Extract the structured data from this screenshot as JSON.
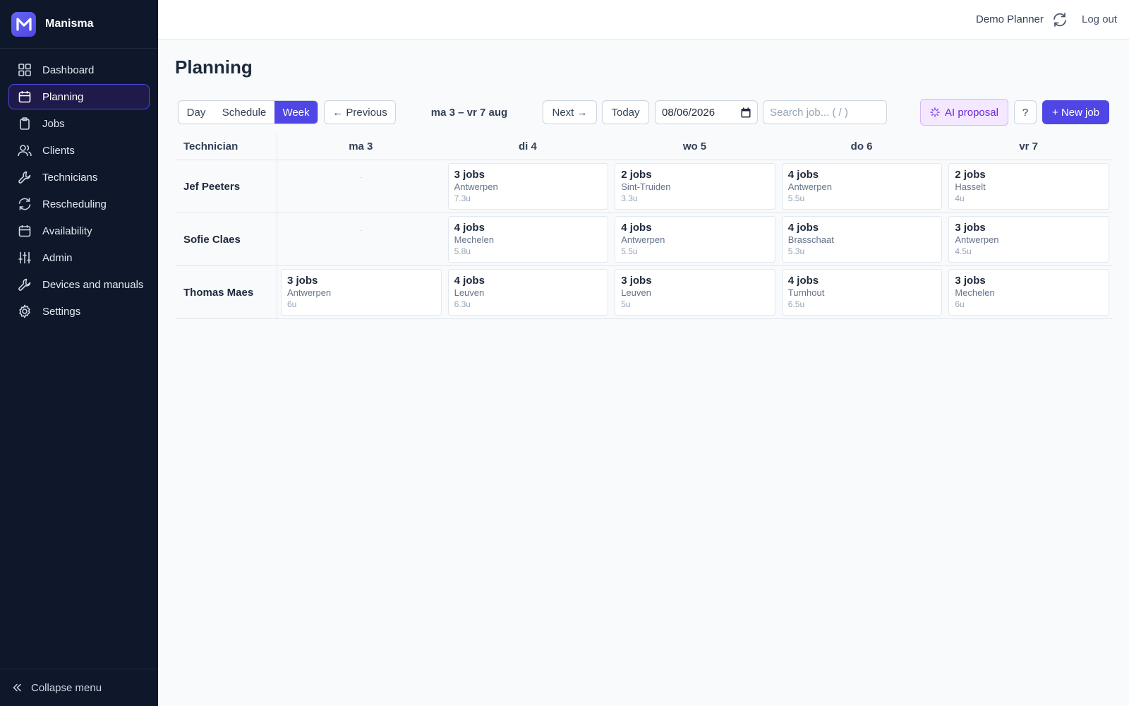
{
  "app": {
    "name": "Manisma"
  },
  "sidebar": {
    "items": [
      {
        "label": "Dashboard",
        "icon": "grid-icon",
        "active": false
      },
      {
        "label": "Planning",
        "icon": "calendar-icon",
        "active": true
      },
      {
        "label": "Jobs",
        "icon": "clipboard-icon",
        "active": false
      },
      {
        "label": "Clients",
        "icon": "users-icon",
        "active": false
      },
      {
        "label": "Technicians",
        "icon": "wrench-icon",
        "active": false
      },
      {
        "label": "Rescheduling",
        "icon": "refresh-icon",
        "active": false
      },
      {
        "label": "Availability",
        "icon": "calendar-icon",
        "active": false
      },
      {
        "label": "Admin",
        "icon": "sliders-icon",
        "active": false
      },
      {
        "label": "Devices and manuals",
        "icon": "wrench-icon",
        "active": false
      },
      {
        "label": "Settings",
        "icon": "gear-icon",
        "active": false
      }
    ],
    "collapse_label": "Collapse menu"
  },
  "topbar": {
    "user": "Demo Planner",
    "logout": "Log out"
  },
  "page": {
    "title": "Planning"
  },
  "toolbar": {
    "views": [
      "Day",
      "Schedule",
      "Week"
    ],
    "active_view": "Week",
    "previous": "← Previous",
    "range": "ma 3 – vr 7 aug",
    "next": "Next →",
    "today": "Today",
    "date_value": "08/06/2026",
    "search_placeholder": "Search job... ( / )",
    "ai_proposal": "AI proposal",
    "help": "?",
    "new_job": "+ New job"
  },
  "colors": {
    "accent": "#4f46e5",
    "sidebar_bg": "#0f172a",
    "ai_bg": "#f3e8ff",
    "ai_text": "#6d28d9"
  },
  "grid": {
    "tech_header": "Technician",
    "days": [
      "ma 3",
      "di 4",
      "wo 5",
      "do 6",
      "vr 7"
    ],
    "rows": [
      {
        "technician": "Jef Peeters",
        "cells": [
          null,
          {
            "jobs": "3 jobs",
            "city": "Antwerpen",
            "hours": "7.3u"
          },
          {
            "jobs": "2 jobs",
            "city": "Sint-Truiden",
            "hours": "3.3u"
          },
          {
            "jobs": "4 jobs",
            "city": "Antwerpen",
            "hours": "5.5u"
          },
          {
            "jobs": "2 jobs",
            "city": "Hasselt",
            "hours": "4u"
          }
        ]
      },
      {
        "technician": "Sofie Claes",
        "cells": [
          null,
          {
            "jobs": "4 jobs",
            "city": "Mechelen",
            "hours": "5.8u"
          },
          {
            "jobs": "4 jobs",
            "city": "Antwerpen",
            "hours": "5.5u"
          },
          {
            "jobs": "4 jobs",
            "city": "Brasschaat",
            "hours": "5.3u"
          },
          {
            "jobs": "3 jobs",
            "city": "Antwerpen",
            "hours": "4.5u"
          }
        ]
      },
      {
        "technician": "Thomas Maes",
        "cells": [
          {
            "jobs": "3 jobs",
            "city": "Antwerpen",
            "hours": "6u"
          },
          {
            "jobs": "4 jobs",
            "city": "Leuven",
            "hours": "6.3u"
          },
          {
            "jobs": "3 jobs",
            "city": "Leuven",
            "hours": "5u"
          },
          {
            "jobs": "4 jobs",
            "city": "Turnhout",
            "hours": "6.5u"
          },
          {
            "jobs": "3 jobs",
            "city": "Mechelen",
            "hours": "6u"
          }
        ]
      }
    ]
  }
}
